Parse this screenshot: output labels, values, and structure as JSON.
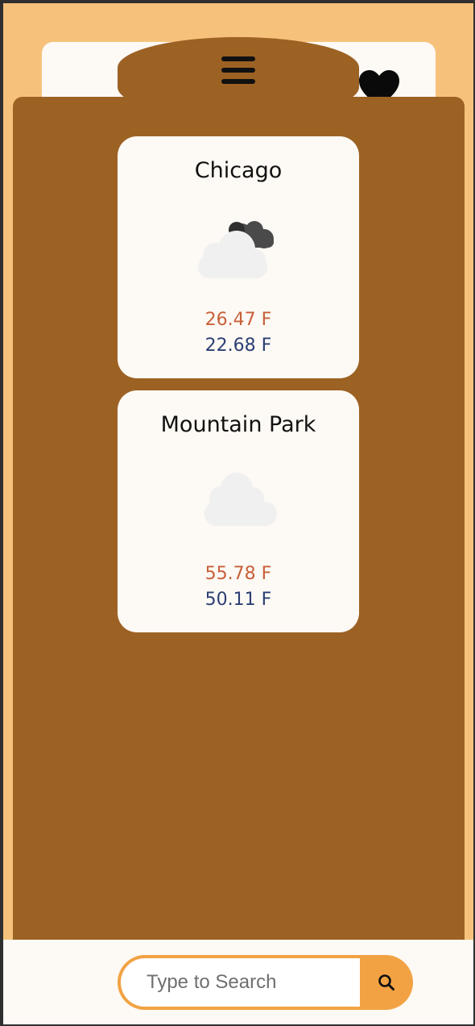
{
  "header": {
    "menu_icon": "hamburger-menu-icon",
    "favorite_icon": "heart-icon"
  },
  "cities": [
    {
      "name": "Chicago",
      "weather_icon": "partly-cloudy-night-icon",
      "temp_high": "26.47 F",
      "temp_low": "22.68 F"
    },
    {
      "name": "Mountain Park",
      "weather_icon": "cloud-icon",
      "temp_high": "55.78 F",
      "temp_low": "50.11 F"
    }
  ],
  "search": {
    "placeholder": "Type to Search",
    "value": "",
    "button_icon": "search-icon"
  },
  "colors": {
    "page_background": "#f6c27b",
    "panel_brown": "#9c6224",
    "card_background": "#fdf9f4",
    "accent_orange": "#f2a243",
    "temp_high_color": "#c8603a",
    "temp_low_color": "#2b3f73"
  }
}
